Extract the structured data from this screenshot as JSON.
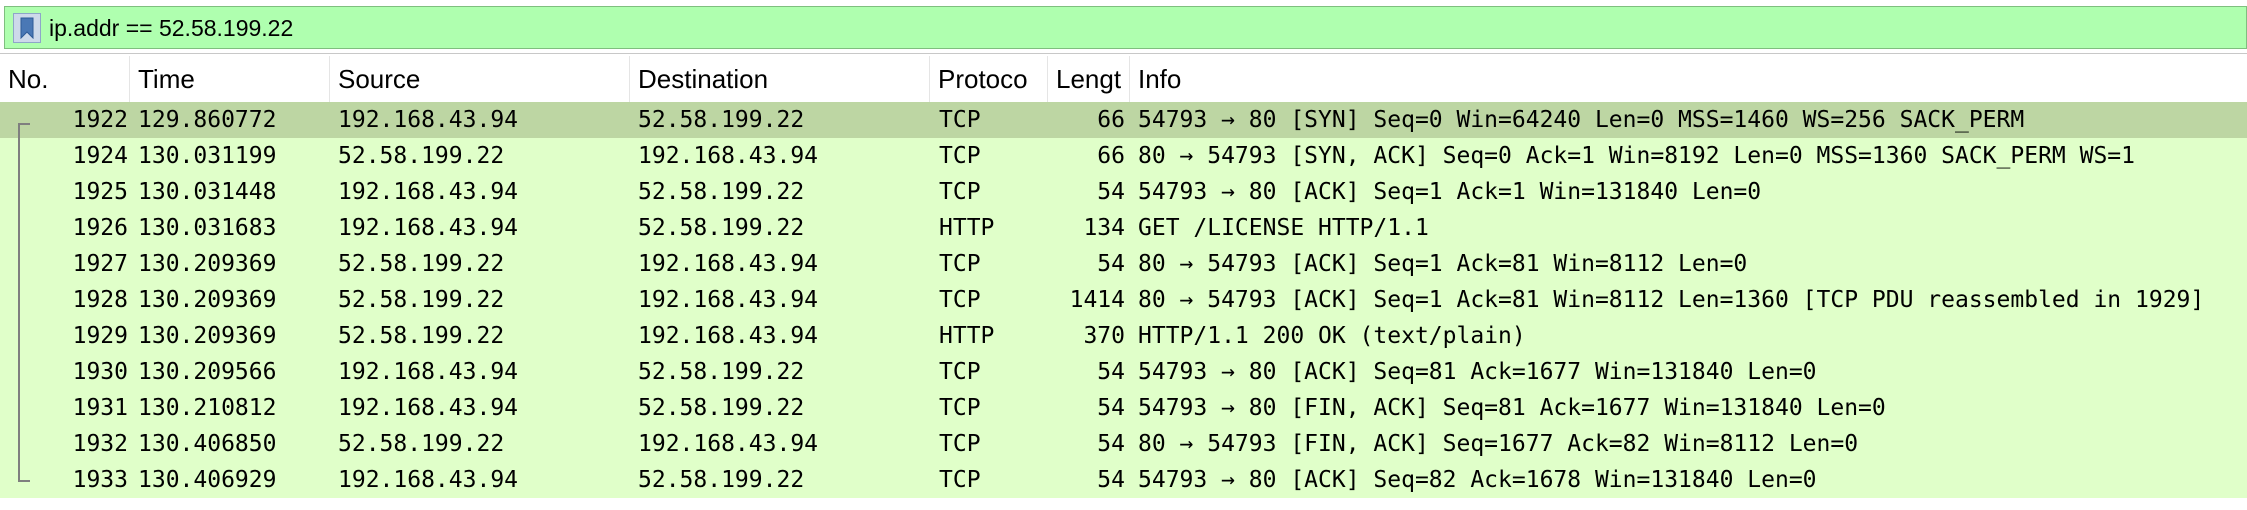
{
  "filter": {
    "icon": "bookmark-icon",
    "value": "ip.addr == 52.58.199.22"
  },
  "columns": [
    "No.",
    "Time",
    "Source",
    "Destination",
    "Protoco",
    "Lengt",
    "Info"
  ],
  "packets": [
    {
      "no": "1922",
      "time": "129.860772",
      "source": "192.168.43.94",
      "destination": "52.58.199.22",
      "protocol": "TCP",
      "length": "66",
      "info": "54793 → 80 [SYN] Seq=0 Win=64240 Len=0 MSS=1460 WS=256 SACK_PERM",
      "selected": true
    },
    {
      "no": "1924",
      "time": "130.031199",
      "source": "52.58.199.22",
      "destination": "192.168.43.94",
      "protocol": "TCP",
      "length": "66",
      "info": "80 → 54793 [SYN, ACK] Seq=0 Ack=1 Win=8192 Len=0 MSS=1360 SACK_PERM WS=1"
    },
    {
      "no": "1925",
      "time": "130.031448",
      "source": "192.168.43.94",
      "destination": "52.58.199.22",
      "protocol": "TCP",
      "length": "54",
      "info": "54793 → 80 [ACK] Seq=1 Ack=1 Win=131840 Len=0"
    },
    {
      "no": "1926",
      "time": "130.031683",
      "source": "192.168.43.94",
      "destination": "52.58.199.22",
      "protocol": "HTTP",
      "length": "134",
      "info": "GET /LICENSE HTTP/1.1"
    },
    {
      "no": "1927",
      "time": "130.209369",
      "source": "52.58.199.22",
      "destination": "192.168.43.94",
      "protocol": "TCP",
      "length": "54",
      "info": "80 → 54793 [ACK] Seq=1 Ack=81 Win=8112 Len=0"
    },
    {
      "no": "1928",
      "time": "130.209369",
      "source": "52.58.199.22",
      "destination": "192.168.43.94",
      "protocol": "TCP",
      "length": "1414",
      "info": "80 → 54793 [ACK] Seq=1 Ack=81 Win=8112 Len=1360 [TCP PDU reassembled in 1929]"
    },
    {
      "no": "1929",
      "time": "130.209369",
      "source": "52.58.199.22",
      "destination": "192.168.43.94",
      "protocol": "HTTP",
      "length": "370",
      "info": "HTTP/1.1 200 OK  (text/plain)"
    },
    {
      "no": "1930",
      "time": "130.209566",
      "source": "192.168.43.94",
      "destination": "52.58.199.22",
      "protocol": "TCP",
      "length": "54",
      "info": "54793 → 80 [ACK] Seq=81 Ack=1677 Win=131840 Len=0"
    },
    {
      "no": "1931",
      "time": "130.210812",
      "source": "192.168.43.94",
      "destination": "52.58.199.22",
      "protocol": "TCP",
      "length": "54",
      "info": "54793 → 80 [FIN, ACK] Seq=81 Ack=1677 Win=131840 Len=0"
    },
    {
      "no": "1932",
      "time": "130.406850",
      "source": "52.58.199.22",
      "destination": "192.168.43.94",
      "protocol": "TCP",
      "length": "54",
      "info": "80 → 54793 [FIN, ACK] Seq=1677 Ack=82 Win=8112 Len=0"
    },
    {
      "no": "1933",
      "time": "130.406929",
      "source": "192.168.43.94",
      "destination": "52.58.199.22",
      "protocol": "TCP",
      "length": "54",
      "info": "54793 → 80 [ACK] Seq=82 Ack=1678 Win=131840 Len=0"
    }
  ],
  "colors": {
    "filter_valid_bg": "#afffaf",
    "row_bg": "#e0ffc9",
    "row_selected_bg": "#bdd6a3"
  }
}
